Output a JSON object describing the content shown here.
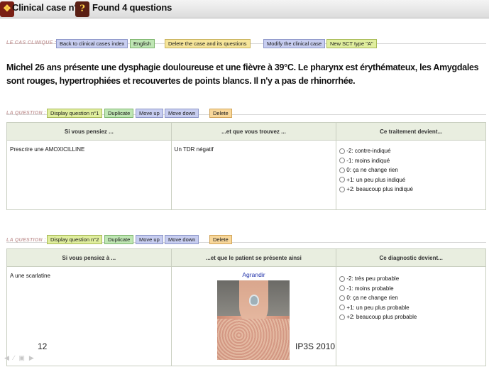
{
  "header": {
    "tab1_icon": "puzzle-icon",
    "tab1_title": "Clinical case n°1",
    "tab2_icon": "question-mark-icon",
    "tab2_title": "Found 4 questions"
  },
  "case": {
    "label": "LE CAS CLINIQUE :",
    "buttons": {
      "back": "Back to clinical cases index",
      "english": "English",
      "delete": "Delete the case and its questions",
      "modify": "Modify the clinical case",
      "new_sct": "New SCT type \"A\""
    },
    "text": "Michel 26 ans présente une dysphagie douloureuse et une fièvre à 39°C. Le pharynx est érythémateux, les Amygdales sont rouges, hypertrophiées et recouvertes de points blancs. Il n'y a pas de rhinorrhée."
  },
  "questions": [
    {
      "label": "LA QUESTION :",
      "buttons": {
        "display": "Display question n°1",
        "duplicate": "Duplicate",
        "move_up": "Move up",
        "move_down": "Move down",
        "delete": "Delete"
      },
      "headers": [
        "Si vous pensiez ...",
        "...et que vous trouvez ...",
        "Ce traitement devient..."
      ],
      "hypothesis": "Prescrire une AMOXICILLINE",
      "finding": "Un TDR négatif",
      "options": [
        "-2: contre-indiqué",
        "-1: moins indiqué",
        "0: ça ne change rien",
        "+1: un peu plus indiqué",
        "+2: beaucoup plus indiqué"
      ]
    },
    {
      "label": "LA QUESTION :",
      "buttons": {
        "display": "Display question n°2",
        "duplicate": "Duplicate",
        "move_up": "Move up",
        "move_down": "Move down",
        "delete": "Delete"
      },
      "headers": [
        "Si vous pensiez à ...",
        "...et que le patient se présente ainsi",
        "Ce diagnostic devient..."
      ],
      "hypothesis": "A une scarlatine",
      "enlarge_link": "Agrandir",
      "options": [
        "-2: très peu probable",
        "-1: moins probable",
        "0: ça ne change rien",
        "+1: un peu plus probable",
        "+2: beaucoup plus probable"
      ]
    }
  ],
  "footer": {
    "page_number": "12",
    "credit": "IP3S 2010"
  },
  "colors": {
    "btn_blue": "#c7cdf0",
    "btn_green": "#bfe6b4",
    "btn_yellow": "#f6e59a",
    "header_cell": "#e9eee0",
    "icon_bg": "#7a1f14"
  }
}
